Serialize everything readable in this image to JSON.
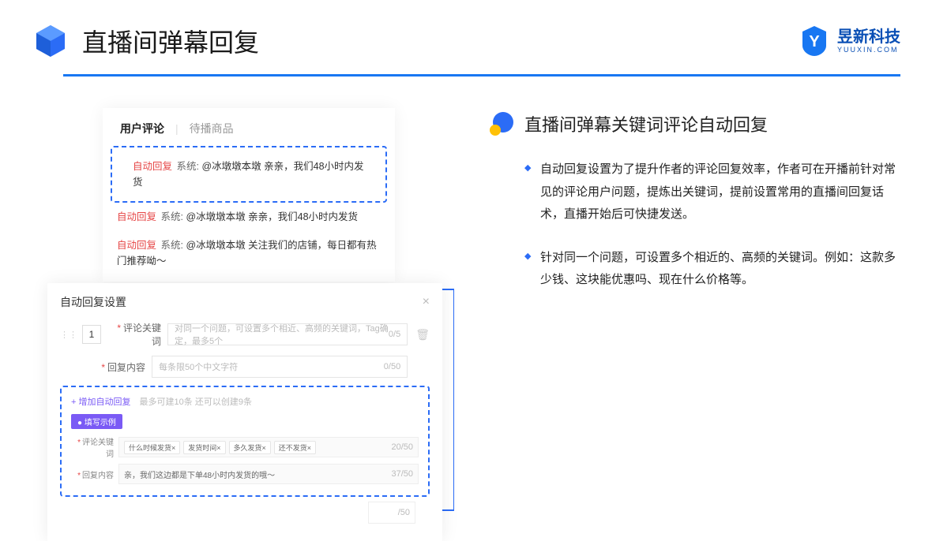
{
  "header": {
    "title": "直播间弹幕回复",
    "brand_cn": "昱新科技",
    "brand_en": "YUUXIN.COM"
  },
  "comments_card": {
    "tabs": {
      "active": "用户评论",
      "inactive": "待播商品"
    },
    "items": [
      {
        "tag": "自动回复",
        "sys": "系统:",
        "text": "@冰墩墩本墩 亲亲，我们48小时内发货",
        "hl": true
      },
      {
        "tag": "自动回复",
        "sys": "系统:",
        "text": "@冰墩墩本墩 亲亲，我们48小时内发货",
        "hl": false
      },
      {
        "tag": "自动回复",
        "sys": "系统:",
        "text": "@冰墩墩本墩 关注我们的店铺，每日都有热门推荐呦～",
        "hl": false
      }
    ]
  },
  "settings_card": {
    "title": "自动回复设置",
    "index": "1",
    "kw_label": "评论关键词",
    "kw_placeholder": "对同一个问题，可设置多个相近、高频的关键词，Tag确定，最多5个",
    "kw_count": "0/5",
    "reply_label": "回复内容",
    "reply_placeholder": "每条限50个中文字符",
    "reply_count": "0/50",
    "add_text": "+ 增加自动回复",
    "add_hint": "最多可建10条 还可以创建9条",
    "example_badge": "● 填写示例",
    "ex_kw_label": "评论关键词",
    "ex_kw_chips": [
      "什么时候发货×",
      "发货时间×",
      "多久发货×",
      "还不发货×"
    ],
    "ex_kw_count": "20/50",
    "ex_reply_label": "回复内容",
    "ex_reply_text": "亲，我们这边都是下单48小时内发货的哦～",
    "ex_reply_count": "37/50",
    "stub_count": "/50"
  },
  "right": {
    "section_title": "直播间弹幕关键词评论自动回复",
    "bullets": [
      "自动回复设置为了提升作者的评论回复效率，作者可在开播前针对常见的评论用户问题，提炼出关键词，提前设置常用的直播间回复话术，直播开始后可快捷发送。",
      "针对同一个问题，可设置多个相近的、高频的关键词。例如：这款多少钱、这块能优惠吗、现在什么价格等。"
    ]
  }
}
